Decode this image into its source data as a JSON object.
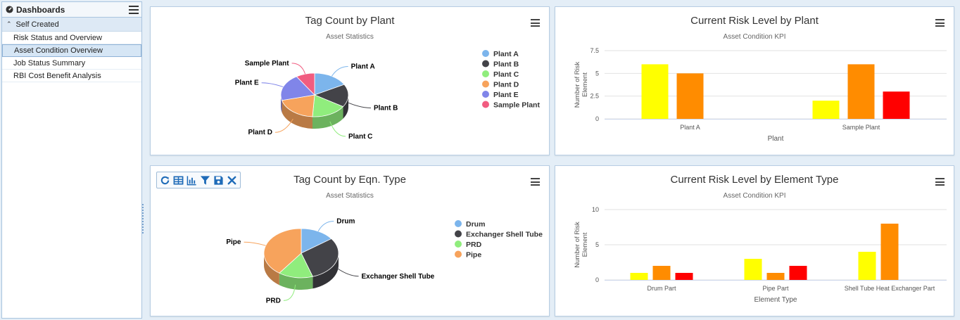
{
  "sidebar": {
    "title": "Dashboards",
    "group": "Self Created",
    "items": [
      {
        "label": "Risk Status and Overview"
      },
      {
        "label": "Asset Condition Overview"
      },
      {
        "label": "Job Status Summary"
      },
      {
        "label": "RBI Cost Benefit Analysis"
      }
    ]
  },
  "panels": {
    "p1": {
      "title": "Tag Count by Plant",
      "subtitle": "Asset Statistics"
    },
    "p2": {
      "title": "Current Risk Level by Plant",
      "subtitle": "Asset Condition KPI"
    },
    "p3": {
      "title": "Tag Count by Eqn. Type",
      "subtitle": "Asset Statistics"
    },
    "p4": {
      "title": "Current Risk Level by Element Type",
      "subtitle": "Asset Condition KPI"
    }
  },
  "toolbar": {
    "icons": [
      "refresh-icon",
      "table-icon",
      "chart-icon",
      "filter-icon",
      "save-icon",
      "close-icon"
    ]
  },
  "colors": {
    "yellow": "#ffff00",
    "orange": "#ff8c00",
    "red": "#ff0000"
  },
  "chart_data": [
    {
      "type": "pie",
      "title": "Tag Count by Plant",
      "subtitle": "Asset Statistics",
      "legend": "right",
      "slices": [
        {
          "name": "Plant A",
          "value": 17,
          "color": "#7cb5ec"
        },
        {
          "name": "Plant B",
          "value": 17,
          "color": "#434348"
        },
        {
          "name": "Plant C",
          "value": 17,
          "color": "#90ed7d"
        },
        {
          "name": "Plant D",
          "value": 20,
          "color": "#f7a35c"
        },
        {
          "name": "Plant E",
          "value": 20,
          "color": "#8085e9"
        },
        {
          "name": "Sample Plant",
          "value": 9,
          "color": "#f15c80"
        }
      ]
    },
    {
      "type": "bar",
      "title": "Current Risk Level by Plant",
      "subtitle": "Asset Condition KPI",
      "xlabel": "Plant",
      "ylabel": "Number of Risk Element",
      "categories": [
        "Plant A",
        "Sample Plant"
      ],
      "yticks": [
        "0",
        "2.5",
        "5",
        "7.5"
      ],
      "ylim": [
        0,
        7.5
      ],
      "grid": true,
      "series": [
        {
          "values": [
            6,
            2
          ],
          "color": "#ffff00"
        },
        {
          "values": [
            5,
            6
          ],
          "color": "#ff8c00"
        },
        {
          "values": [
            0,
            3
          ],
          "color": "#ff0000"
        }
      ]
    },
    {
      "type": "pie",
      "title": "Tag Count by Eqn. Type",
      "subtitle": "Asset Statistics",
      "legend": "right",
      "slices": [
        {
          "name": "Drum",
          "value": 15,
          "color": "#7cb5ec"
        },
        {
          "name": "Exchanger Shell Tube",
          "value": 30,
          "color": "#434348"
        },
        {
          "name": "PRD",
          "value": 15,
          "color": "#90ed7d"
        },
        {
          "name": "Pipe",
          "value": 40,
          "color": "#f7a35c"
        }
      ]
    },
    {
      "type": "bar",
      "title": "Current Risk Level by Element Type",
      "subtitle": "Asset Condition KPI",
      "xlabel": "Element Type",
      "ylabel": "Number of Risk Element",
      "categories": [
        "Drum Part",
        "Pipe Part",
        "Shell Tube Heat Exchanger Part"
      ],
      "yticks": [
        "0",
        "5",
        "10"
      ],
      "ylim": [
        0,
        10
      ],
      "grid": true,
      "series": [
        {
          "values": [
            1,
            3,
            4
          ],
          "color": "#ffff00"
        },
        {
          "values": [
            2,
            1,
            8
          ],
          "color": "#ff8c00"
        },
        {
          "values": [
            1,
            2,
            0
          ],
          "color": "#ff0000"
        }
      ]
    }
  ]
}
